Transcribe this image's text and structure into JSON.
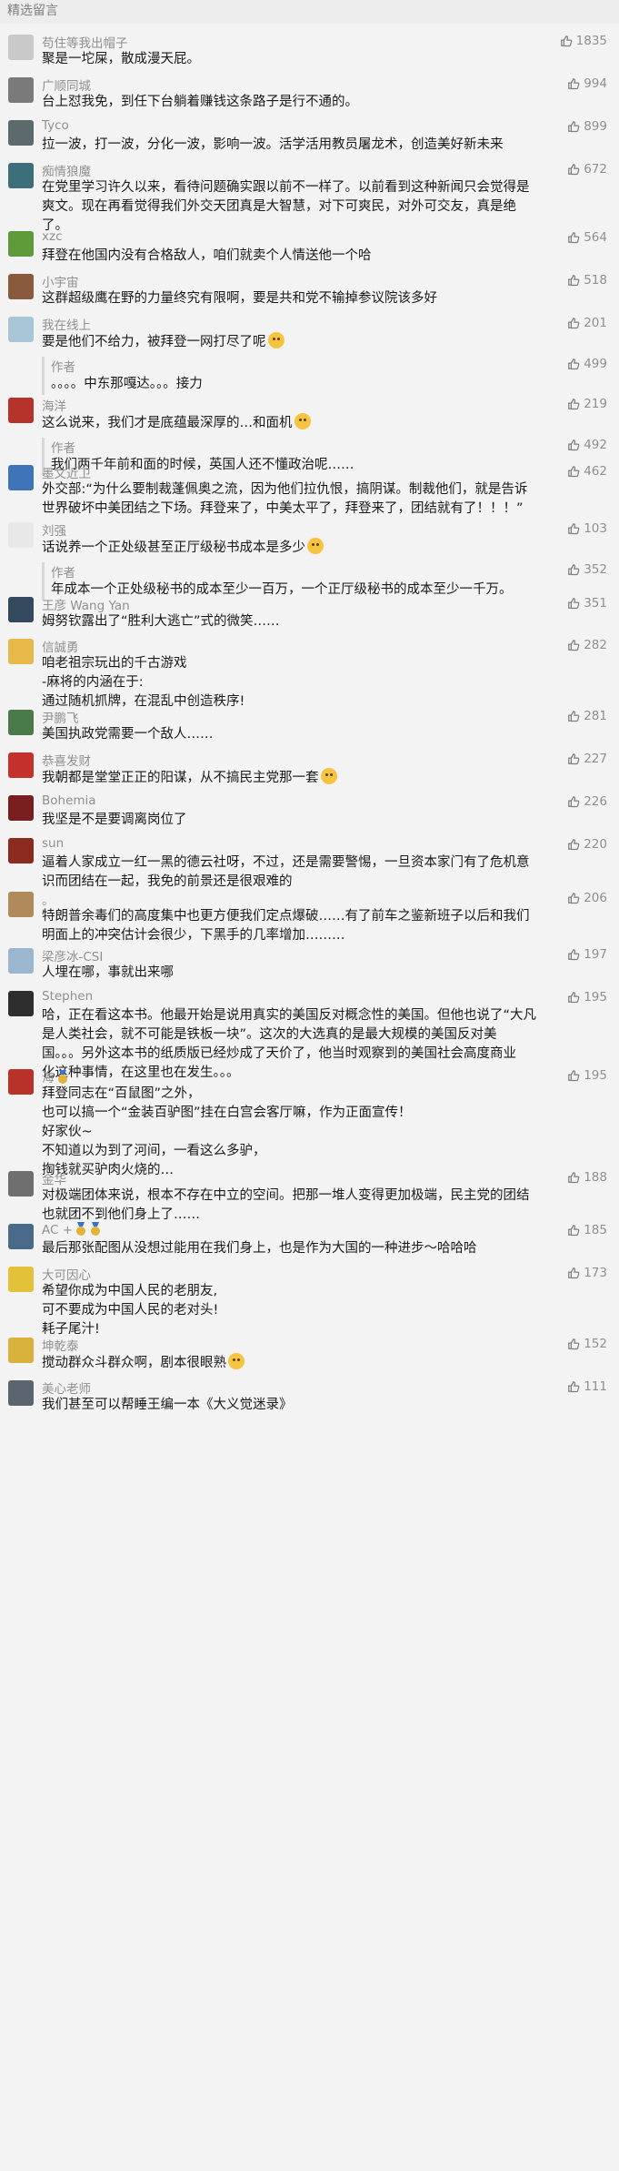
{
  "header": {
    "title": "精选留言"
  },
  "reply_author_label": "作者",
  "comments": [
    {
      "nickname": "苟住等我出帽子",
      "likes": "1835",
      "avatar_color": "#c9c9c9",
      "lines": [
        "聚是一坨屎，散成漫天屁。"
      ]
    },
    {
      "nickname": "广顺同城",
      "likes": "994",
      "avatar_color": "#7a7a7a",
      "lines": [
        "台上怼我免，到任下台躺着赚钱这条路子是行不通的。"
      ]
    },
    {
      "nickname": "Tyco",
      "likes": "899",
      "avatar_color": "#5d6a6d",
      "lines": [
        "拉一波，打一波，分化一波，影响一波。活学活用教员屠龙术，创造美好新未来"
      ]
    },
    {
      "nickname": "痴情狼魔",
      "likes": "672",
      "avatar_color": "#3d6f7a",
      "lines": [
        "在党里学习许久以来，看待问题确实跟以前不一样了。以前看到这种新闻只会觉得是",
        "爽文。现在再看觉得我们外交天团真是大智慧，对下可爽民，对外可交友，真是绝",
        "了。"
      ]
    },
    {
      "nickname": "xzc",
      "likes": "564",
      "avatar_color": "#5f9a3a",
      "lines": [
        "拜登在他国内没有合格敌人，咱们就卖个人情送他一个哈"
      ]
    },
    {
      "nickname": "小宇宙",
      "likes": "518",
      "avatar_color": "#8a5a3c",
      "lines": [
        "这群超级鹰在野的力量终究有限啊，要是共和党不输掉参议院该多好"
      ]
    },
    {
      "nickname": "我在线上",
      "likes": "201",
      "avatar_color": "#a9c6d9",
      "lines": [
        "要是他们不给力，被拜登一网打尽了呢"
      ],
      "emoji": true,
      "reply": {
        "likes": "499",
        "lines": [
          "。。。。中东那嘎达。。。接力"
        ]
      }
    },
    {
      "nickname": "海洋",
      "likes": "219",
      "avatar_color": "#b6332c",
      "lines": [
        "这么说来，我们才是底蕴最深厚的…和面机"
      ],
      "emoji": true,
      "reply": {
        "likes": "492",
        "lines": [
          "我们两千年前和面的时候，英国人还不懂政治呢……"
        ]
      }
    },
    {
      "nickname": "墨文近卫",
      "likes": "462",
      "avatar_color": "#3f74b8",
      "lines": [
        "外交部:“为什么要制裁蓬佩奥之流，因为他们拉仇恨，搞阴谋。制裁他们，就是告诉",
        "世界破坏中美团结之下场。拜登来了，中美太平了，拜登来了，团结就有了！！！”"
      ]
    },
    {
      "nickname": "刘强",
      "likes": "103",
      "avatar_color": "#e8e8e8",
      "lines": [
        "话说养一个正处级甚至正厅级秘书成本是多少"
      ],
      "emoji": true,
      "reply": {
        "likes": "352",
        "lines": [
          "年成本一个正处级秘书的成本至少一百万，一个正厅级秘书的成本至少一千万。"
        ]
      }
    },
    {
      "nickname": "王彦 Wang Yan",
      "likes": "351",
      "avatar_color": "#34495e",
      "lines": [
        "姆努钦露出了“胜利大逃亡”式的微笑……"
      ]
    },
    {
      "nickname": "信誠勇",
      "likes": "282",
      "avatar_color": "#e7b84a",
      "lines": [
        "咱老祖宗玩出的千古游戏",
        "-麻将的内涵在于:",
        "通过随机抓牌，在混乱中创造秩序!"
      ]
    },
    {
      "nickname": "尹鹏飞",
      "likes": "281",
      "avatar_color": "#4b7a4a",
      "lines": [
        "美国执政党需要一个敌人……"
      ]
    },
    {
      "nickname": "恭喜发财",
      "likes": "227",
      "avatar_color": "#c4312b",
      "lines": [
        "我朝都是堂堂正正的阳谋，从不搞民主党那一套"
      ],
      "emoji": true
    },
    {
      "nickname": "Bohemia",
      "likes": "226",
      "avatar_color": "#7a1f1f",
      "lines": [
        "我坚是不是要调离岗位了"
      ]
    },
    {
      "nickname": "sun",
      "likes": "220",
      "avatar_color": "#8b2a1e",
      "lines": [
        "逼着人家成立一红一黑的德云社呀，不过，还是需要警惕，一旦资本家门有了危机意",
        "识而团结在一起，我免的前景还是很艰难的"
      ]
    },
    {
      "nickname": "。",
      "likes": "206",
      "avatar_color": "#b08a5a",
      "lines": [
        "特朗普余毒们的高度集中也更方便我们定点爆破……有了前车之鉴新班子以后和我们",
        "明面上的冲突估计会很少，下黑手的几率增加………"
      ]
    },
    {
      "nickname": "梁彦冰-CSI",
      "likes": "197",
      "avatar_color": "#9bb7cf",
      "lines": [
        "人埋在哪，事就出来哪"
      ]
    },
    {
      "nickname": "Stephen",
      "likes": "195",
      "avatar_color": "#2e2e2e",
      "lines": [
        "哈，正在看这本书。他最开始是说用真实的美国反对概念性的美国。但他也说了“大凡",
        "是人类社会，就不可能是铁板一块”。这次的大选真的是最大规模的美国反对美",
        "国。。。另外这本书的纸质版已经炒成了天价了，他当时观察到的美国社会高度商业",
        "化这种事情，在这里也在发生。。。"
      ]
    },
    {
      "nickname": "海",
      "likes": "195",
      "avatar_color": "#b8322a",
      "lines": [
        "拜登同志在“百鼠图”之外，",
        "也可以搞一个“金装百驴图”挂在白宫会客厅嘛，作为正面宣传！",
        "好家伙~",
        "不知道以为到了河间，一看这么多驴，",
        "掏钱就买驴肉火烧的…"
      ],
      "badge": 1
    },
    {
      "nickname": "金华",
      "likes": "188",
      "avatar_color": "#6f6f6f",
      "lines": [
        "对极端团体来说，根本不存在中立的空间。把那一堆人变得更加极端，民主党的团结",
        "也就团不到他们身上了……"
      ]
    },
    {
      "nickname": "AC +",
      "likes": "185",
      "avatar_color": "#4a6a8a",
      "lines": [
        "最后那张配图从没想过能用在我们身上，也是作为大国的一种进步～哈哈哈"
      ],
      "badge": 2
    },
    {
      "nickname": "大可因心",
      "likes": "173",
      "avatar_color": "#e3c23a",
      "lines": [
        "希望你成为中国人民的老朋友,",
        "可不要成为中国人民的老对头!",
        "耗子尾汁!"
      ]
    },
    {
      "nickname": "坤乾泰",
      "likes": "152",
      "avatar_color": "#d8b23c",
      "lines": [
        "搅动群众斗群众啊，剧本很眼熟"
      ],
      "emoji": true
    },
    {
      "nickname": "美心老师",
      "likes": "111",
      "avatar_color": "#5a6570",
      "lines": [
        "我们甚至可以帮睡王编一本《大义觉迷录》"
      ]
    }
  ]
}
